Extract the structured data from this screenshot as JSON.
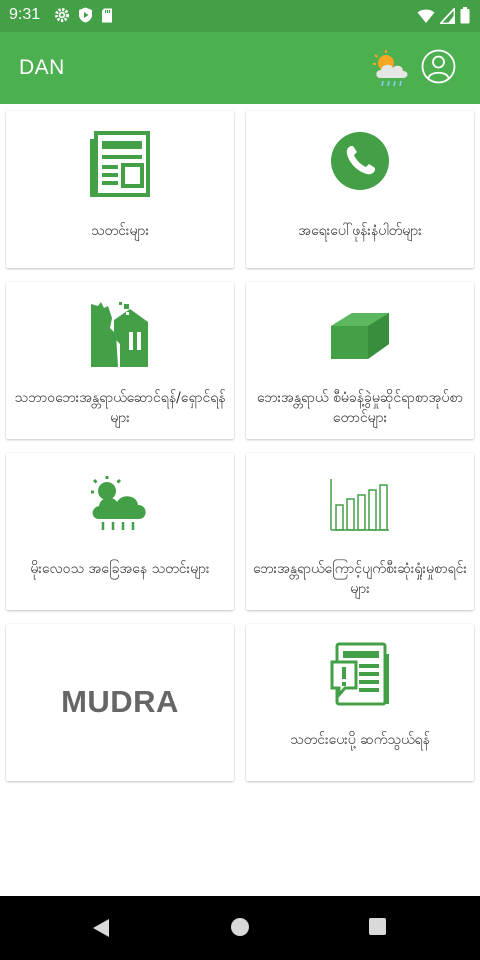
{
  "status_bar": {
    "time": "9:31",
    "icons_left": [
      "gear-icon",
      "shield-play-icon",
      "sd-card-icon"
    ],
    "icons_right": [
      "wifi-icon",
      "signal-icon",
      "battery-icon"
    ]
  },
  "app_bar": {
    "title": "DAN",
    "actions": [
      "weather-icon",
      "profile-icon"
    ]
  },
  "theme": {
    "primary": "#4caf50",
    "status": "#43a047",
    "icon_green": "#43a047",
    "text": "#333333",
    "mudra_text": "#666666"
  },
  "cards": [
    {
      "icon": "newspaper-icon",
      "label": "သတင်းများ"
    },
    {
      "icon": "phone-icon",
      "label": "အရေးပေါ်ဖုန်းနံပါတ်များ"
    },
    {
      "icon": "disaster-icon",
      "label": "သဘာဝဘေးအန္တရာယ်ဆောင်ရန်/ရှောင်ရန်များ"
    },
    {
      "icon": "map-layers-icon",
      "label": "ဘေးအန္တရာယ် စီမံခန့်ခွဲမှုဆိုင်ရာစာအုပ်စာတောင်များ"
    },
    {
      "icon": "weather-rain-icon",
      "label": "မိုးလေဝသ အခြေအနေ သတင်းများ"
    },
    {
      "icon": "bar-chart-icon",
      "label": "ဘေးအန္တရာယ်ကြောင့်ပျက်စီးဆုံးရှုံးမှုစာရင်းများ"
    },
    {
      "icon": "mudra-logo",
      "label": "MUDRA"
    },
    {
      "icon": "report-news-icon",
      "label": "သတင်းပေးပို့ ဆက်သွယ်ရန်"
    }
  ],
  "nav_bar": [
    "back-icon",
    "home-icon",
    "recents-icon"
  ]
}
